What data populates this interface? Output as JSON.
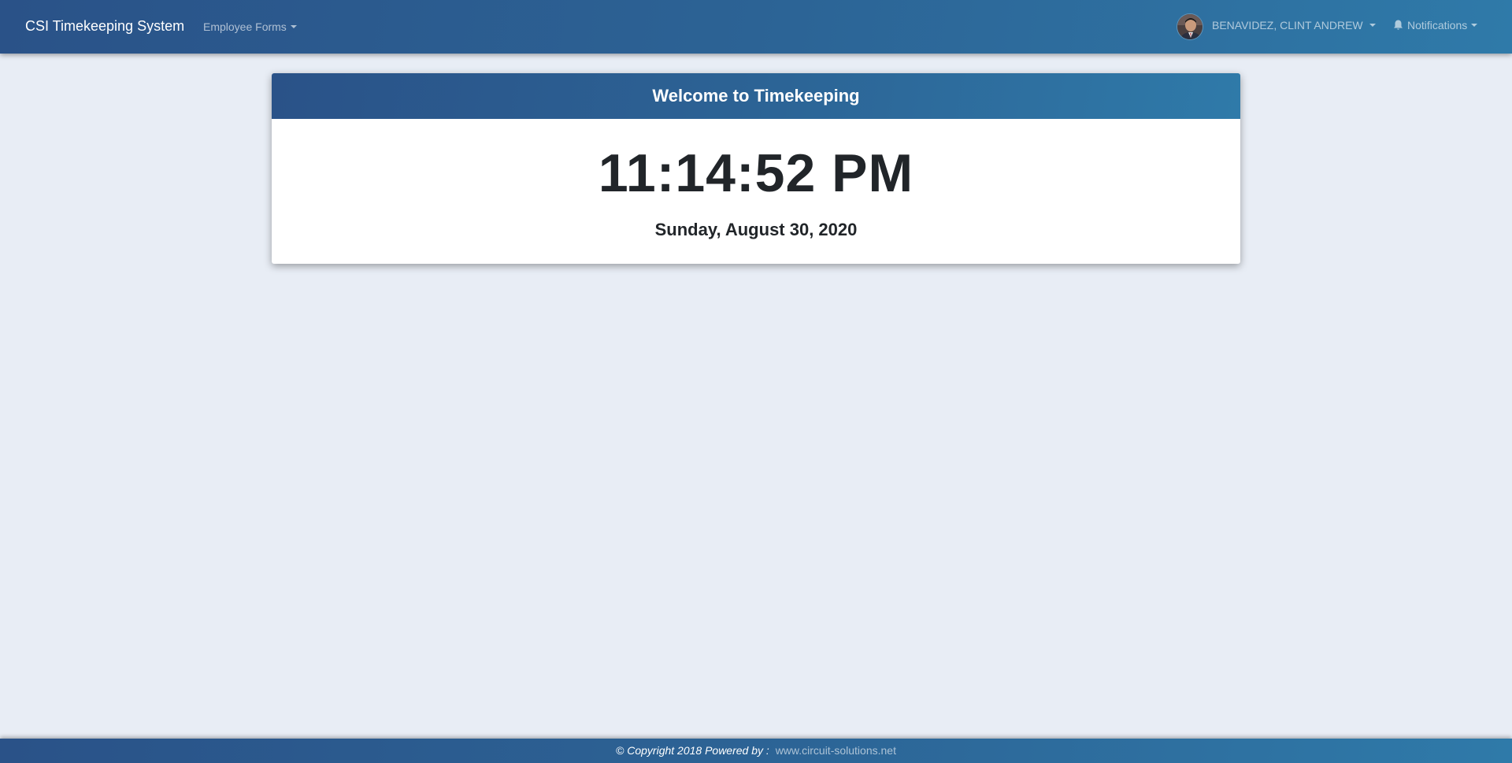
{
  "navbar": {
    "brand": "CSI Timekeeping System",
    "forms_menu": "Employee Forms",
    "user_name": "BENAVIDEZ, CLINT ANDREW",
    "notifications": "Notifications"
  },
  "card": {
    "title": "Welcome to Timekeeping",
    "time": "11:14:52 PM",
    "date": "Sunday, August 30, 2020"
  },
  "footer": {
    "copyright": "© Copyright 2018 Powered by :",
    "site": "www.circuit-solutions.net"
  },
  "colors": {
    "primary": "#2c6395",
    "background": "#e8edf5",
    "text": "#212529"
  },
  "icons": {
    "avatar": "user-avatar-photo",
    "notifications": "bell-icon",
    "dropdown": "caret-down-icon"
  }
}
